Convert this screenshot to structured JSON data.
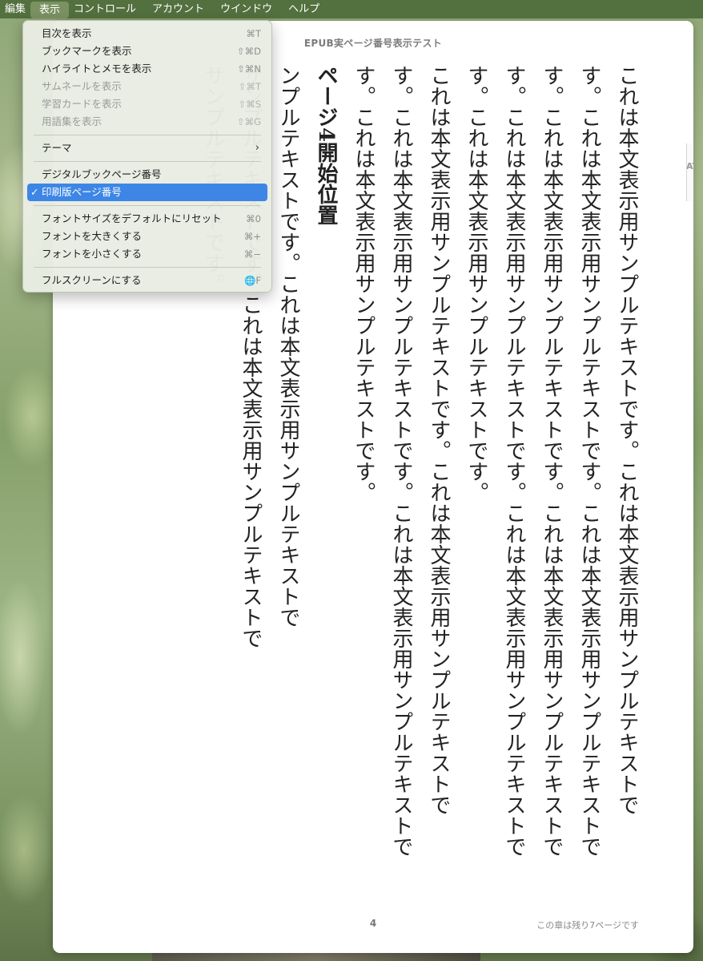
{
  "menubar": {
    "items": [
      "編集",
      "表示",
      "コントロール",
      "アカウント",
      "ウインドウ",
      "ヘルプ"
    ]
  },
  "view_menu": {
    "group1": [
      {
        "label": "目次を表示",
        "shortcut": "⌘T",
        "enabled": true
      },
      {
        "label": "ブックマークを表示",
        "shortcut": "⇧⌘D",
        "enabled": true
      },
      {
        "label": "ハイライトとメモを表示",
        "shortcut": "⇧⌘N",
        "enabled": true
      },
      {
        "label": "サムネールを表示",
        "shortcut": "⇧⌘T",
        "enabled": false
      },
      {
        "label": "学習カードを表示",
        "shortcut": "⇧⌘S",
        "enabled": false
      },
      {
        "label": "用語集を表示",
        "shortcut": "⇧⌘G",
        "enabled": false
      }
    ],
    "theme_label": "テーマ",
    "digital_page_label": "デジタルブックページ番号",
    "print_page_label": "印刷版ページ番号",
    "print_page_checked": "✓",
    "group4": [
      {
        "label": "フォントサイズをデフォルトにリセット",
        "shortcut": "⌘0"
      },
      {
        "label": "フォントを大きくする",
        "shortcut": "⌘+"
      },
      {
        "label": "フォントを小さくする",
        "shortcut": "⌘−"
      }
    ],
    "fullscreen_label": "フルスクリーンにする",
    "fullscreen_shortcut": "🌐F"
  },
  "book": {
    "title": "EPUB実ページ番号表示テスト",
    "next_tab_text": "AT",
    "paragraphs": [
      "これは本文表示用サンプルテキストです。これは本文表示用サンプルテキストで",
      "す。これは本文表示用サンプルテキストです。これは本文表示用サンプルテキストで",
      "す。これは本文表示用サンプルテキストです。これは本文表示用サンプルテキストで",
      "す。これは本文表示用サンプルテキストです。これは本文表示用サンプルテキストで",
      "す。これは本文表示用サンプルテキストです。",
      "これは本文表示用サンプルテキストです。これは本文表示用サンプルテキストで",
      "す。これは本文表示用サンプルテキストです。これは本文表示用サンプルテキストで",
      "す。これは本文表示用サンプルテキストです。"
    ],
    "heading": "ページ4開始位置",
    "after_heading": [
      "ンプルテキストです。これは本文表示用サンプルテキストで",
      "サンプルテキストです。これは本文表示用サンプルテキストで",
      "サンプルテキストです。"
    ],
    "page_number": "4",
    "pages_left": "この章は残り7ページです"
  }
}
